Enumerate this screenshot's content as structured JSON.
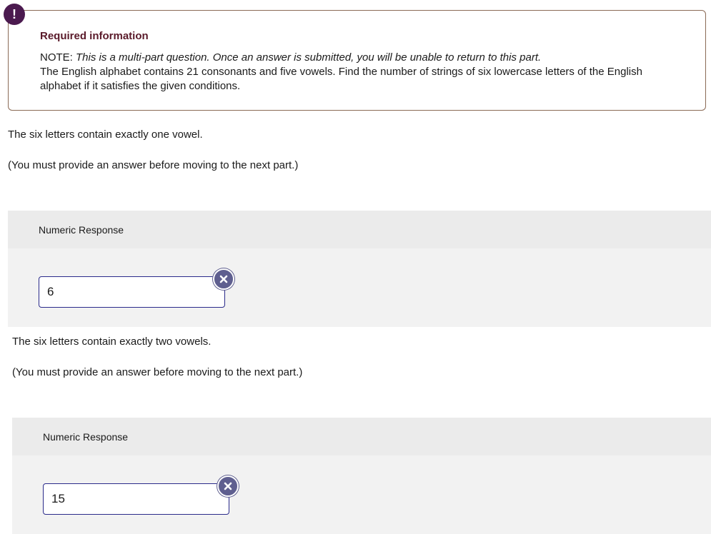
{
  "notice": {
    "title": "Required information",
    "note_prefix": "NOTE: ",
    "note_italic": "This is a multi-part question. Once an answer is submitted, you will be unable to return to this part.",
    "problem": "The English alphabet contains 21 consonants and five vowels. Find the number of strings of six lowercase letters of the English alphabet if it satisfies the given conditions."
  },
  "parts": [
    {
      "question": "The six letters contain exactly one vowel.",
      "instruction": "(You must provide an answer before moving to the next part.)",
      "response_label": "Numeric Response",
      "answer": "6"
    },
    {
      "question": "The six letters contain exactly two vowels.",
      "instruction": "(You must provide an answer before moving to the next part.)",
      "response_label": "Numeric Response",
      "answer": "15"
    }
  ],
  "colors": {
    "badge": "#4b1a4f",
    "title": "#5a1a2a",
    "input_border": "#2a2a8a",
    "clear_button": "#5f5f8f"
  },
  "icons": [
    "alert-icon",
    "clear-icon"
  ]
}
